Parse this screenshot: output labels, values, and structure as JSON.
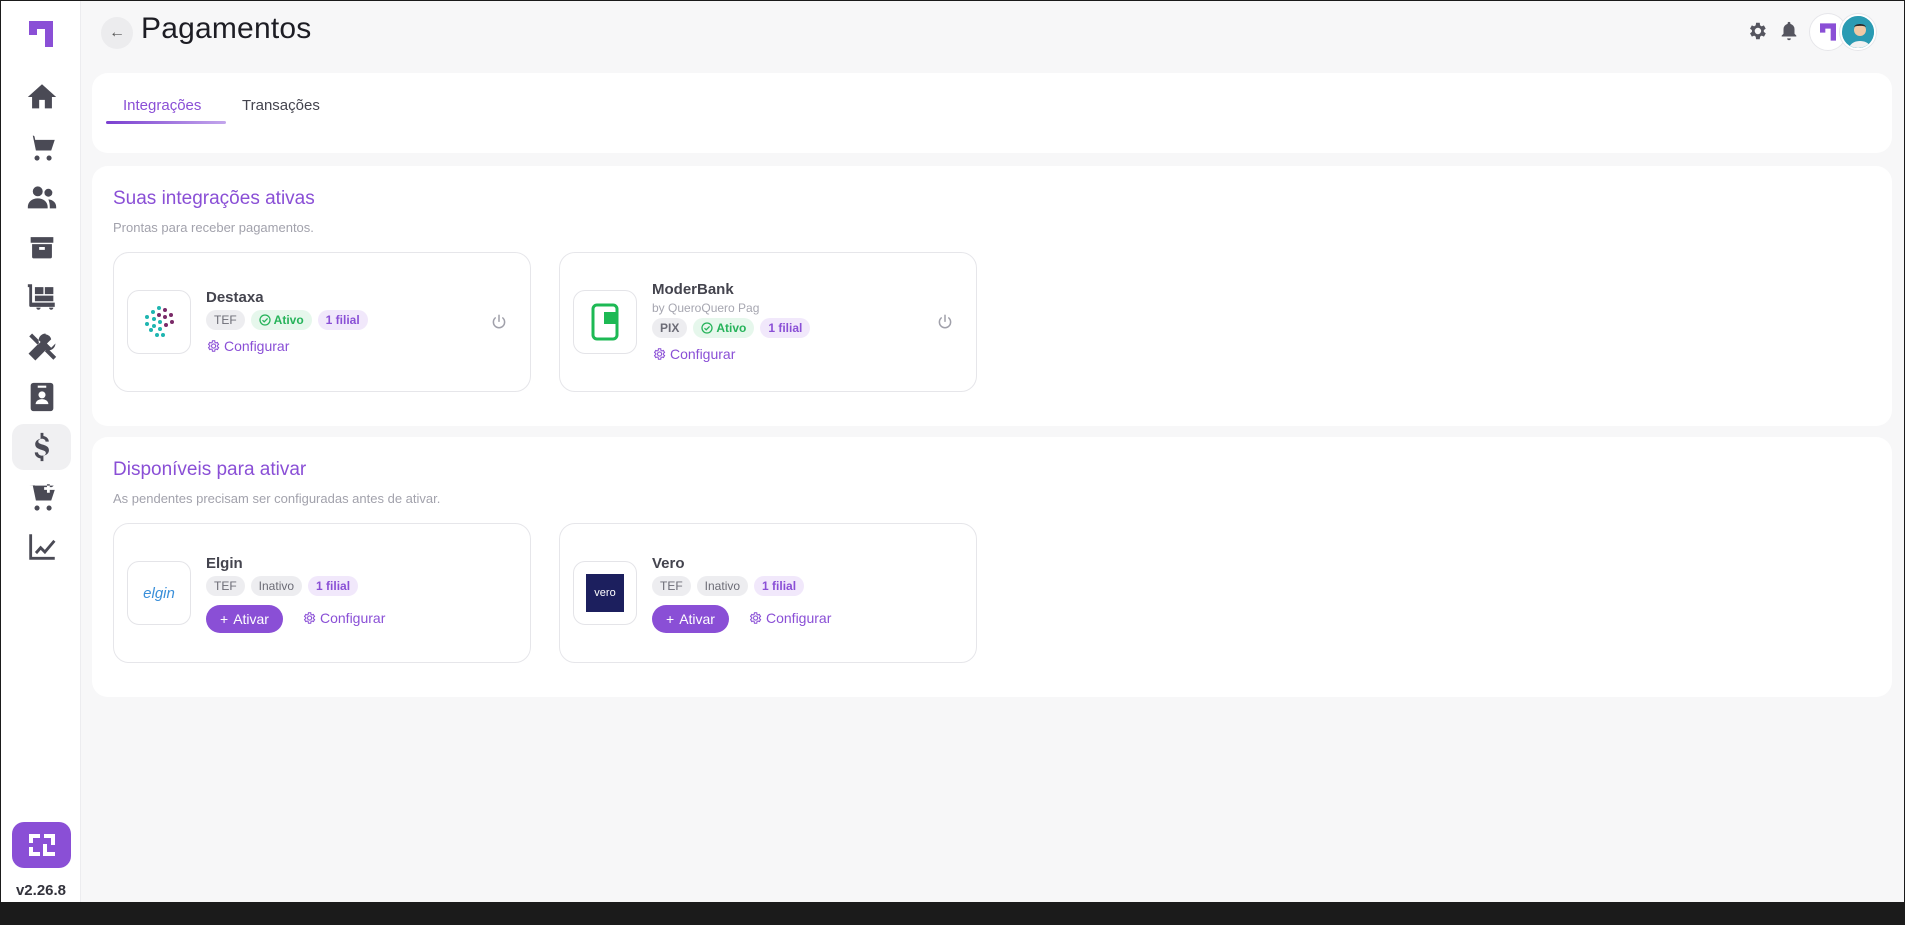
{
  "header": {
    "title": "Pagamentos",
    "back_icon": "arrow-left-icon",
    "settings_icon": "gear-icon",
    "notifications_icon": "bell-icon"
  },
  "sidebar": {
    "version": "v2.26.8",
    "items": [
      {
        "name": "home",
        "icon": "home-icon"
      },
      {
        "name": "cart",
        "icon": "cart-icon"
      },
      {
        "name": "customers",
        "icon": "users-icon"
      },
      {
        "name": "products",
        "icon": "box-icon"
      },
      {
        "name": "logistics",
        "icon": "dolly-icon"
      },
      {
        "name": "tools",
        "icon": "tools-icon"
      },
      {
        "name": "contacts",
        "icon": "contact-card-icon"
      },
      {
        "name": "payments",
        "icon": "dollar-icon",
        "active": true
      },
      {
        "name": "add-to-cart",
        "icon": "cart-plus-icon"
      },
      {
        "name": "reports",
        "icon": "chart-line-icon"
      }
    ]
  },
  "tabs": [
    {
      "label": "Integrações",
      "active": true
    },
    {
      "label": "Transações",
      "active": false
    }
  ],
  "active_section": {
    "title": "Suas integrações ativas",
    "subtitle": "Prontas para receber pagamentos.",
    "cards": [
      {
        "name": "Destaxa",
        "tags": [
          "TEF",
          "Ativo",
          "1 filial"
        ],
        "config_label": "Configurar"
      },
      {
        "name": "ModerBank",
        "subtitle": "by QueroQuero Pag",
        "tags": [
          "PIX",
          "Ativo",
          "1 filial"
        ],
        "config_label": "Configurar"
      }
    ]
  },
  "available_section": {
    "title": "Disponíveis para ativar",
    "subtitle": "As pendentes precisam ser configuradas antes de ativar.",
    "cards": [
      {
        "name": "Elgin",
        "logo_text": "elgin",
        "tags": [
          "TEF",
          "Inativo",
          "1 filial"
        ],
        "activate_label": "Ativar",
        "config_label": "Configurar"
      },
      {
        "name": "Vero",
        "logo_text": "vero",
        "tags": [
          "TEF",
          "Inativo",
          "1 filial"
        ],
        "activate_label": "Ativar",
        "config_label": "Configurar"
      }
    ]
  },
  "colors": {
    "accent": "#8a4fd6",
    "success": "#26b35a"
  }
}
